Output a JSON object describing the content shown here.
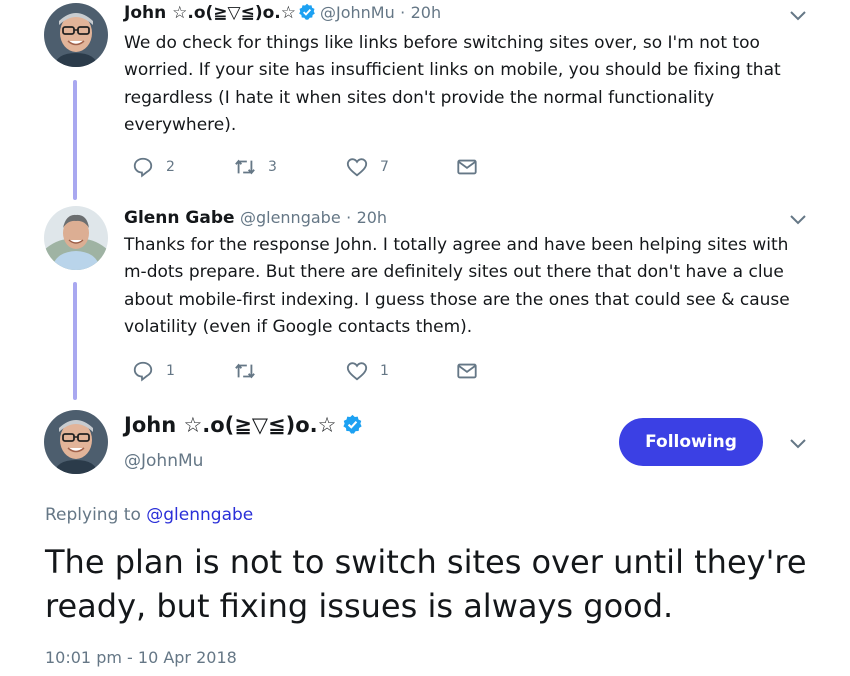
{
  "tweets": [
    {
      "name": "John ☆.o(≧▽≦)o.☆",
      "handle": "@JohnMu",
      "dot": "·",
      "time": "20h",
      "text": "We do check for things like links before switching sites over, so I'm not too worried. If your site has insufficient links on mobile, you should be fixing that regardless (I hate it when sites don't provide the normal functionality everywhere).",
      "replies": "2",
      "retweets": "3",
      "likes": "7"
    },
    {
      "name": "Glenn Gabe",
      "handle": "@glenngabe",
      "dot": "·",
      "time": "20h",
      "text": "Thanks for the response John. I totally agree and have been helping sites with m-dots prepare. But there are definitely sites out there that don't have a clue about mobile-first indexing. I guess those are the ones that could see & cause volatility (even if Google contacts them).",
      "replies": "1",
      "retweets": "",
      "likes": "1"
    }
  ],
  "main": {
    "name": "John ☆.o(≧▽≦)o.☆",
    "handle": "@JohnMu",
    "follow_label": "Following",
    "replying_prefix": "Replying to ",
    "replying_to": "@glenngabe",
    "text": "The plan is not to switch sites over until they're ready, but fixing issues is always good.",
    "timestamp": "10:01 pm - 10 Apr 2018"
  },
  "colors": {
    "accent": "#3b40e4",
    "thread_line": "#a9a8f0",
    "muted": "#657786",
    "verified": "#1da1f2"
  },
  "icons": [
    "reply-icon",
    "retweet-icon",
    "like-icon",
    "direct-message-icon",
    "chevron-down-icon",
    "verified-badge-icon"
  ]
}
